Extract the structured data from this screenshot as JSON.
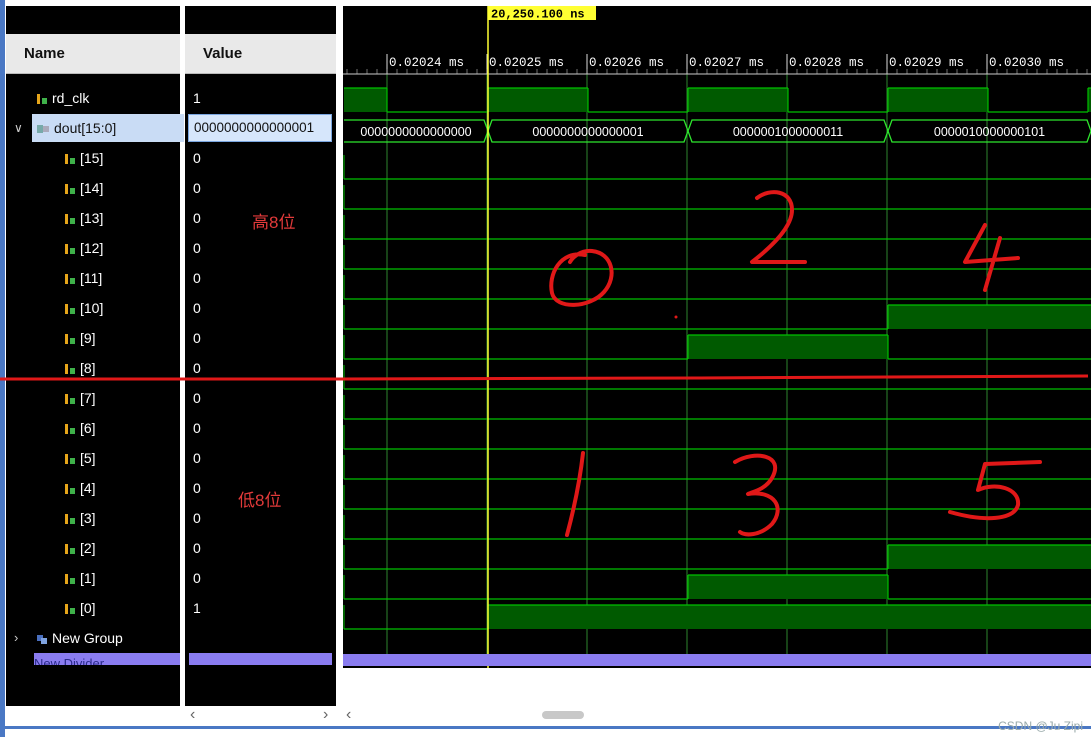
{
  "cursor_label": "20,250.100 ns",
  "headers": {
    "name": "Name",
    "value": "Value"
  },
  "time_ticks": [
    "0.02024 ms",
    "0.02025 ms",
    "0.02026 ms",
    "0.02027 ms",
    "0.02028 ms",
    "0.02029 ms",
    "0.02030 ms"
  ],
  "signals": {
    "rd_clk": {
      "name": "rd_clk",
      "value": "1"
    },
    "dout": {
      "name": "dout[15:0]",
      "value": "0000000000000001"
    },
    "bits": [
      {
        "name": "[15]",
        "value": "0"
      },
      {
        "name": "[14]",
        "value": "0"
      },
      {
        "name": "[13]",
        "value": "0"
      },
      {
        "name": "[12]",
        "value": "0"
      },
      {
        "name": "[11]",
        "value": "0"
      },
      {
        "name": "[10]",
        "value": "0"
      },
      {
        "name": "[9]",
        "value": "0"
      },
      {
        "name": "[8]",
        "value": "0"
      },
      {
        "name": "[7]",
        "value": "0"
      },
      {
        "name": "[6]",
        "value": "0"
      },
      {
        "name": "[5]",
        "value": "0"
      },
      {
        "name": "[4]",
        "value": "0"
      },
      {
        "name": "[3]",
        "value": "0"
      },
      {
        "name": "[2]",
        "value": "0"
      },
      {
        "name": "[1]",
        "value": "0"
      },
      {
        "name": "[0]",
        "value": "1"
      }
    ],
    "group": {
      "name": "New Group"
    },
    "divider": {
      "name": "New Divider"
    }
  },
  "bus_values": [
    "0000000000000000",
    "0000000000000001",
    "0000001000000011",
    "0000010000000101"
  ],
  "annotations": {
    "high": "高8位",
    "low": "低8位",
    "digits": [
      "0",
      "1",
      "2",
      "3",
      "4",
      "5"
    ]
  },
  "watermark": "CSDN @Ju Zipi",
  "colors": {
    "wave_green": "#00c000",
    "wave_fill": "#005a00",
    "bus_green": "#2ee62e",
    "cursor": "#ffff33",
    "divider": "#8a7cf0",
    "annotation": "#e01818"
  }
}
